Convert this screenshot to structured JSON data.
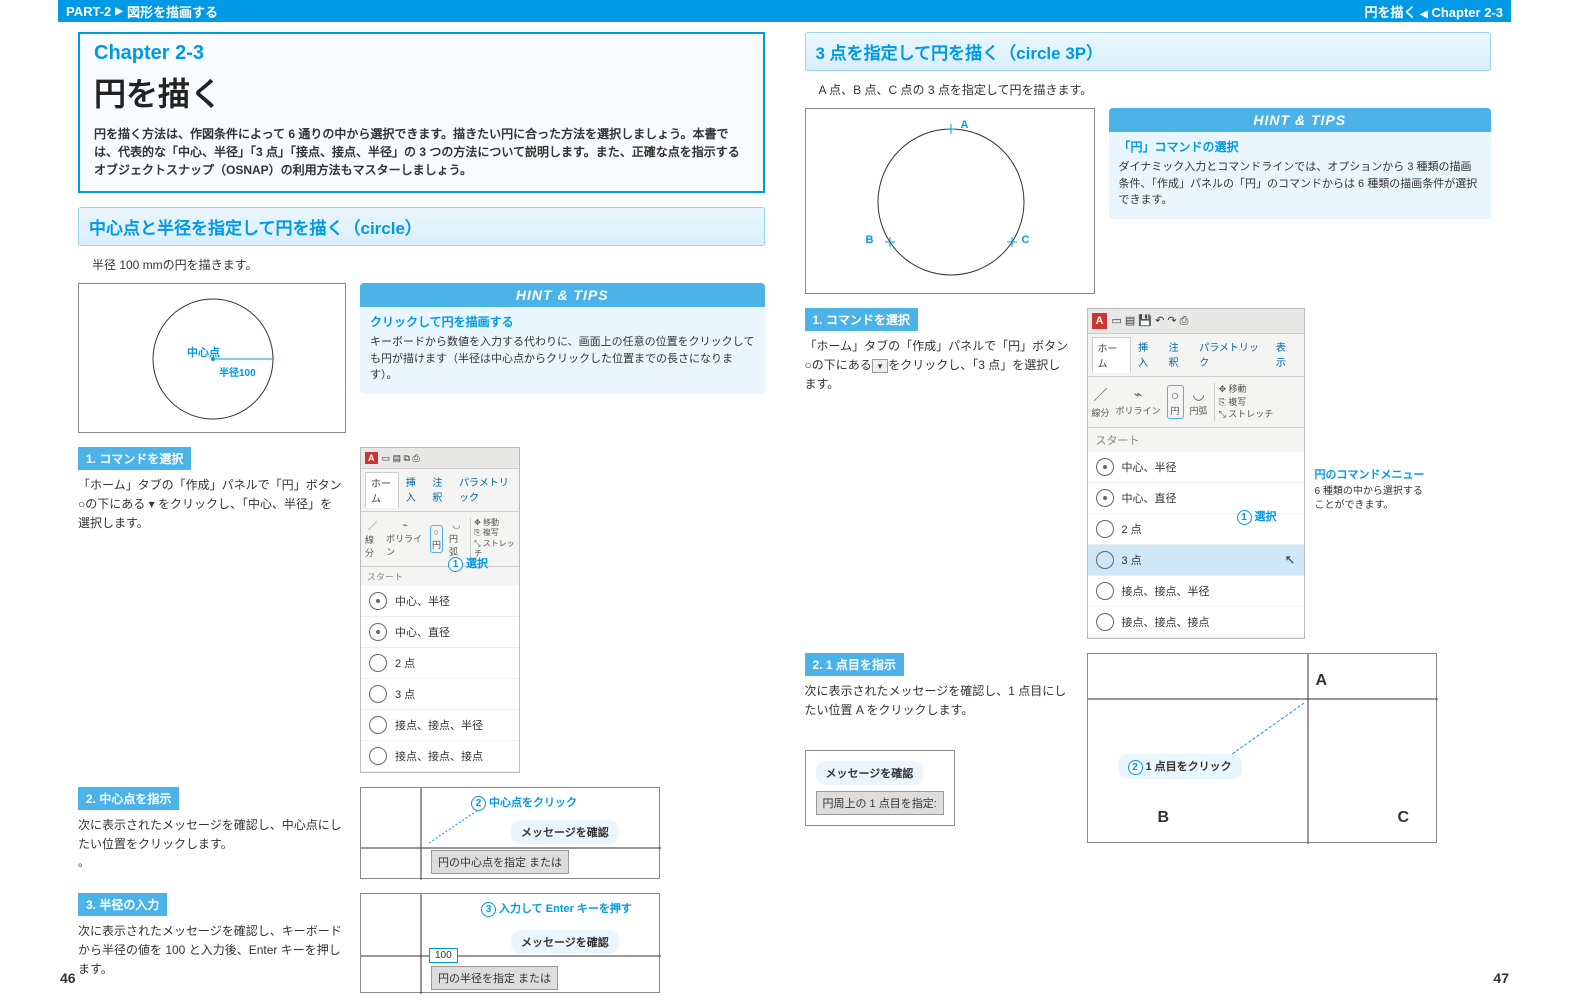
{
  "header": {
    "part": "PART-2",
    "part_title": "図形を描画する",
    "chapter": "Chapter 2-3",
    "chapter_subj": "円を描く"
  },
  "chapterbox": {
    "label": "Chapter 2-3",
    "title": "円を描く",
    "desc": "円を描く方法は、作図条件によって 6 通りの中から選択できます。描きたい円に合った方法を選択しましょう。本書では、代表的な「中心、半径」「3 点」「接点、接点、半径」の 3 つの方法について説明します。また、正確な点を指示するオブジェクトスナップ（OSNAP）の利用方法もマスターしましょう。"
  },
  "sec1": {
    "title": "中心点と半径を指定して円を描く（circle）",
    "lead": "半径 100 mmの円を描きます。",
    "fig_center": "中心点",
    "fig_radius": "半径100",
    "hint": {
      "title": "クリックして円を描画する",
      "body": "キーボードから数値を入力する代わりに、画面上の任意の位置をクリックしても円が描けます（半径は中心点からクリックした位置までの長さになります）。"
    },
    "s1": {
      "bar": "1. コマンドを選択",
      "body": "「ホーム」タブの「作成」パネルで「円」ボタン○の下にある ▾ をクリックし、「中心、半径」を選択します。",
      "anno": "選択"
    },
    "s2": {
      "bar": "2. 中心点を指示",
      "body": "次に表示されたメッセージを確認し、中心点にしたい位置をクリックします。",
      "anno1": "中心点をクリック",
      "anno2": "メッセージを確認",
      "prompt": "円の中心点を指定 または"
    },
    "s3": {
      "bar": "3. 半径の入力",
      "body": "次に表示されたメッセージを確認し、キーボードから半径の値を 100 と入力後、Enter キーを押します。",
      "anno1": "入力して Enter キーを押す",
      "anno2": "メッセージを確認",
      "val": "100",
      "prompt": "円の半径を指定 または"
    }
  },
  "sec2": {
    "title": "3 点を指定して円を描く（circle 3P）",
    "lead": "A 点、B 点、C 点の 3 点を指定して円を描きます。",
    "ptA": "A",
    "ptB": "B",
    "ptC": "C",
    "hint": {
      "title": "「円」コマンドの選択",
      "body": "ダイナミック入力とコマンドラインでは、オプションから 3 種類の描画条件、「作成」パネルの「円」のコマンドからは 6 種類の描画条件が選択できます。"
    },
    "s1": {
      "bar": "1. コマンドを選択",
      "body": "「ホーム」タブの「作成」パネルで「円」ボタン○の下にある ▾ をクリックし、「3 点」を選択します。",
      "anno": "選択",
      "side_title": "円のコマンドメニュー",
      "side_body": "6 種類の中から選択することができます。"
    },
    "s2": {
      "bar": "2. 1 点目を指示",
      "body": "次に表示されたメッセージを確認し、1 点目にしたい位置 A をクリックします。",
      "msg": "メッセージを確認",
      "prompt": "円周上の 1 点目を指定:",
      "anno": "1 点目をクリック"
    }
  },
  "menu": {
    "tabs": [
      "ホーム",
      "挿入",
      "注釈",
      "パラメトリック",
      "表示"
    ],
    "tool_line": "線分",
    "tool_poly": "ポリライン",
    "tool_circle": "円",
    "tool_arc": "円弧",
    "r_move": "移動",
    "r_copy": "複写",
    "r_stretch": "ストレッチ",
    "start": "スタート",
    "items_small": [
      "中心、半径",
      "中心、直径",
      "2 点",
      "3 点",
      "接点、接点、半径",
      "接点、接点、接点"
    ],
    "items_big": [
      "中心、半径",
      "中心、直径",
      "2 点",
      "3 点",
      "接点、接点、半径",
      "接点、接点、接点"
    ]
  },
  "hint_label": "HINT & TIPS",
  "pages": {
    "l": "46",
    "r": "47"
  }
}
